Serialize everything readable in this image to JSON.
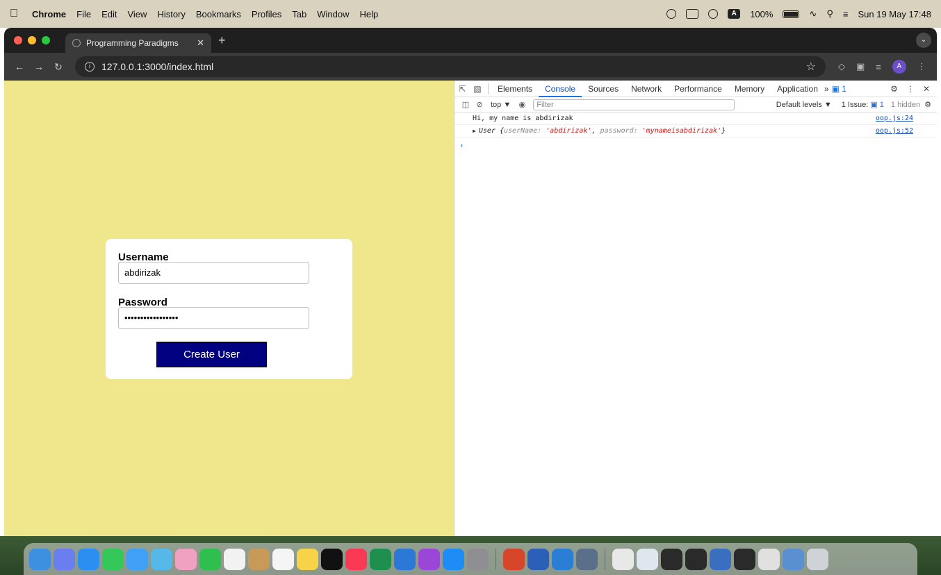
{
  "menubar": {
    "app_name": "Chrome",
    "menus": [
      "File",
      "Edit",
      "View",
      "History",
      "Bookmarks",
      "Profiles",
      "Tab",
      "Window",
      "Help"
    ],
    "battery": "100%",
    "clock": "Sun 19 May  17:48"
  },
  "browser": {
    "tab_title": "Programming Paradigms",
    "url": "127.0.0.1:3000/index.html",
    "profile_initial": "A"
  },
  "form": {
    "username_label": "Username",
    "username_value": "abdirizak",
    "password_label": "Password",
    "password_value": "•••••••••••••••••",
    "submit_label": "Create User"
  },
  "devtools": {
    "tabs": [
      "Elements",
      "Console",
      "Sources",
      "Network",
      "Performance",
      "Memory",
      "Application"
    ],
    "active_tab": "Console",
    "issue_badge": "1",
    "context": "top ▼",
    "filter_placeholder": "Filter",
    "levels": "Default levels ▼",
    "issues_label": "1 Issue:",
    "issues_count": "1",
    "hidden_label": "1 hidden",
    "console": [
      {
        "text": "Hi, my name is abdirizak",
        "source": "oop.js:24"
      },
      {
        "object_name": "User",
        "open": "{",
        "key1": "userName",
        "val1": "'abdirizak'",
        "key2": "password",
        "val2": "'mynameisabdirizak'",
        "close": "}",
        "source": "oop.js:52"
      }
    ]
  },
  "colors": {
    "page_background": "#f0e68c",
    "button_background": "#000080",
    "devtools_accent": "#1a73e8"
  }
}
